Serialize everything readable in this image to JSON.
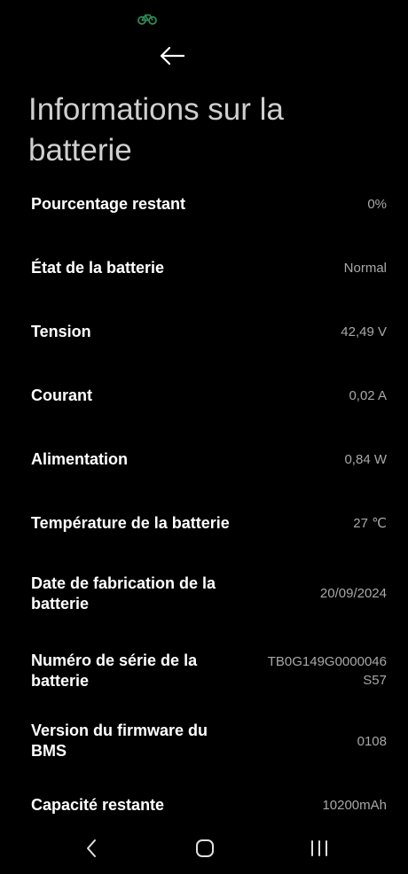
{
  "status_bar": {
    "icon": "bike-icon",
    "icon_color": "#2e8b57"
  },
  "header": {
    "back_icon": "arrow-left-icon",
    "title": "Informations sur la batterie"
  },
  "rows": [
    {
      "label": "Pourcentage restant",
      "value": "0%"
    },
    {
      "label": "État de la batterie",
      "value": "Normal"
    },
    {
      "label": "Tension",
      "value": "42,49 V"
    },
    {
      "label": "Courant",
      "value": "0,02 A"
    },
    {
      "label": "Alimentation",
      "value": "0,84 W"
    },
    {
      "label": "Température de la batterie",
      "value": "27 ℃"
    },
    {
      "label": "Date de fabrication de la batterie",
      "value": "20/09/2024"
    },
    {
      "label": "Numéro de série de la batterie",
      "value": "TB0G149G0000046S57"
    },
    {
      "label": "Version du firmware du BMS",
      "value": "0108"
    },
    {
      "label": "Capacité restante",
      "value": "10200mAh"
    }
  ],
  "nav_bar": {
    "back_icon": "chevron-left-icon",
    "home_icon": "home-rounded-square-icon",
    "recents_icon": "recents-bars-icon"
  },
  "colors": {
    "background": "#000000",
    "label_text": "#ffffff",
    "value_text": "#a8a8a8",
    "title_text": "#cfcfcf"
  }
}
